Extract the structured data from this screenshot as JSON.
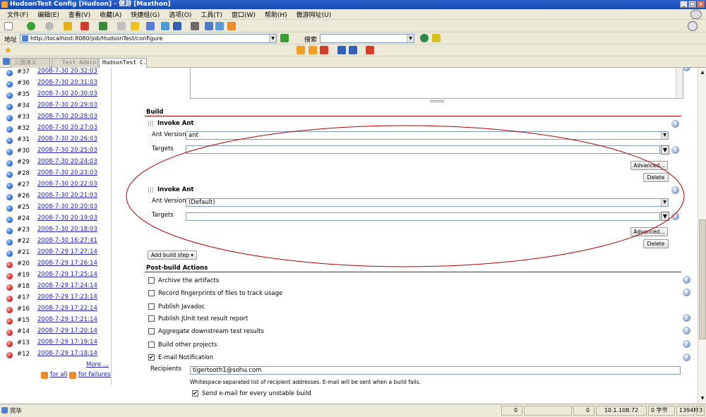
{
  "window": {
    "title": "HudsonTest Config [Hudson] - 傲游 [Maxthon]",
    "buttons": [
      "_",
      "□",
      "×"
    ]
  },
  "menu": [
    "文件(F)",
    "编辑(E)",
    "查看(V)",
    "收藏(A)",
    "快捷组(G)",
    "选项(O)",
    "工具(T)",
    "窗口(W)",
    "帮助(H)",
    "傲游网址(U)"
  ],
  "address": {
    "label": "地址",
    "url": "http://localhost:8080/job/HudsonTest/configure"
  },
  "search": {
    "label": "搜索",
    "value": ""
  },
  "tabs": [
    "三国演义...",
    "Test Admin",
    "HudsonTest C..."
  ],
  "history": [
    {
      "num": "#37",
      "date": "2008-7-30 20:32:03",
      "status": "blue"
    },
    {
      "num": "#36",
      "date": "2008-7-30 20:31:03",
      "status": "blue"
    },
    {
      "num": "#35",
      "date": "2008-7-30 20:30:03",
      "status": "blue"
    },
    {
      "num": "#34",
      "date": "2008-7-30 20:29:03",
      "status": "blue"
    },
    {
      "num": "#33",
      "date": "2008-7-30 20:28:03",
      "status": "blue"
    },
    {
      "num": "#32",
      "date": "2008-7-30 20:27:03",
      "status": "blue"
    },
    {
      "num": "#31",
      "date": "2008-7-30 20:26:03",
      "status": "blue"
    },
    {
      "num": "#30",
      "date": "2008-7-30 20:25:03",
      "status": "blue"
    },
    {
      "num": "#29",
      "date": "2008-7-30 20:24:03",
      "status": "blue"
    },
    {
      "num": "#28",
      "date": "2008-7-30 20:23:03",
      "status": "blue"
    },
    {
      "num": "#27",
      "date": "2008-7-30 20:22:03",
      "status": "blue"
    },
    {
      "num": "#26",
      "date": "2008-7-30 20:21:03",
      "status": "blue"
    },
    {
      "num": "#25",
      "date": "2008-7-30 20:20:03",
      "status": "blue"
    },
    {
      "num": "#24",
      "date": "2008-7-30 20:19:03",
      "status": "blue"
    },
    {
      "num": "#23",
      "date": "2008-7-30 20:18:03",
      "status": "blue"
    },
    {
      "num": "#22",
      "date": "2008-7-30 16:27:41",
      "status": "blue"
    },
    {
      "num": "#21",
      "date": "2008-7-29 17:27:14",
      "status": "blue"
    },
    {
      "num": "#20",
      "date": "2008-7-29 17:26:14",
      "status": "red"
    },
    {
      "num": "#19",
      "date": "2008-7-29 17:25:14",
      "status": "red"
    },
    {
      "num": "#18",
      "date": "2008-7-29 17:24:14",
      "status": "red"
    },
    {
      "num": "#17",
      "date": "2008-7-29 17:23:14",
      "status": "red"
    },
    {
      "num": "#16",
      "date": "2008-7-29 17:22:14",
      "status": "red"
    },
    {
      "num": "#15",
      "date": "2008-7-29 17:21:14",
      "status": "red"
    },
    {
      "num": "#14",
      "date": "2008-7-29 17:20:14",
      "status": "red"
    },
    {
      "num": "#13",
      "date": "2008-7-29 17:19:14",
      "status": "red"
    },
    {
      "num": "#12",
      "date": "2008-7-29 17:18:14",
      "status": "red"
    }
  ],
  "history_more": "More ...",
  "rss_all": "for all",
  "rss_failures": "for failures",
  "build": {
    "title": "Build",
    "steps": [
      {
        "title": "Invoke Ant",
        "ant_version_label": "Ant Version",
        "ant_version": "ant",
        "targets_label": "Targets",
        "targets": "",
        "advanced": "Advanced...",
        "delete": "Delete"
      },
      {
        "title": "Invoke Ant",
        "ant_version_label": "Ant Version",
        "ant_version": "(Default)",
        "targets_label": "Targets",
        "targets": "",
        "advanced": "Advanced...",
        "delete": "Delete"
      }
    ],
    "add_step": "Add build step ▾"
  },
  "post_build": {
    "title": "Post-build Actions",
    "actions": [
      {
        "label": "Archive the artifacts",
        "checked": false
      },
      {
        "label": "Record fingerprints of files to track usage",
        "checked": false
      },
      {
        "label": "Publish Javadoc",
        "checked": false
      },
      {
        "label": "Publish JUnit test result report",
        "checked": false
      },
      {
        "label": "Aggregate downstream test results",
        "checked": false
      },
      {
        "label": "Build other projects",
        "checked": false
      },
      {
        "label": "E-mail Notification",
        "checked": true
      }
    ],
    "recipients_label": "Recipients",
    "recipients": "tigertooth1@sohu.com",
    "recipients_desc": "Whitespace-separated list of recipient addresses. E-mail will be sent when a build fails.",
    "unstable_label": "Send e-mail for every unstable build",
    "unstable_checked": true
  },
  "status": {
    "text": "完毕",
    "count1": "0",
    "count2": "0",
    "ip": "10.1.108.72",
    "bytes": "0 字节",
    "mem": "1394M",
    "num": "3"
  },
  "colors": {
    "annotation_ellipse": "#b00000",
    "section_rule": "#b00000",
    "link": "#2222bb"
  }
}
